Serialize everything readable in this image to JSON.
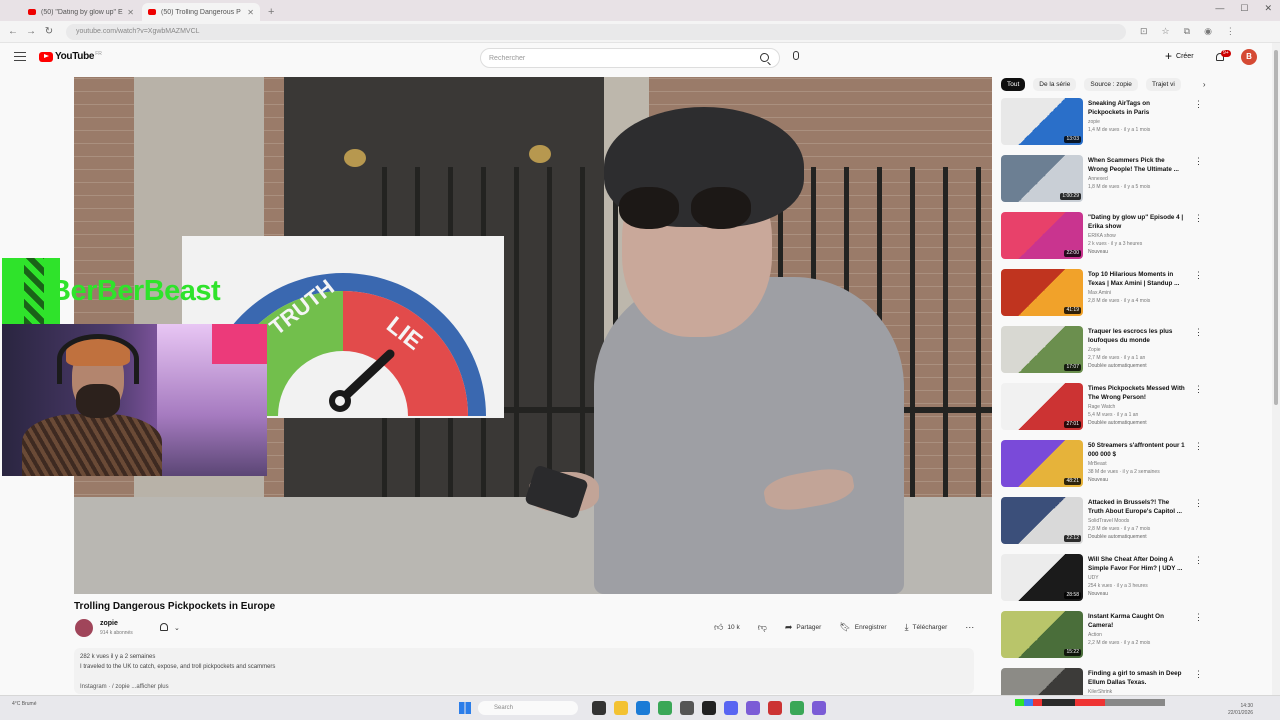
{
  "browser": {
    "tabs": [
      {
        "title": "(50) \"Dating by glow up\" Ep",
        "active": false
      },
      {
        "title": "(50) Trolling Dangerous P",
        "active": true
      }
    ],
    "new_tab": "+",
    "url": "youtube.com/watch?v=XgwbMAZMVCL"
  },
  "header": {
    "logo_text": "YouTube",
    "logo_cc": "FR",
    "search_placeholder": "Rechercher",
    "create_label": "Créer",
    "notifications": "9+",
    "avatar_letter": "B"
  },
  "overlay": {
    "streamer_name": "BerBerBeast",
    "gauge_left": "TRUTH",
    "gauge_right": "LIE"
  },
  "video": {
    "title": "Trolling Dangerous Pickpockets in Europe",
    "channel": "zopie",
    "subs": "914 k abonnés",
    "likes": "10 k",
    "share": "Partager",
    "save": "Enregistrer",
    "download": "Télécharger",
    "views_date": "282 k vues  il y a 2 semaines",
    "description": "I traveled to the UK to catch, expose, and troll pickpockets and scammers",
    "tags": "Instagram  ·  / zopie  ...afficher plus"
  },
  "chips": [
    "Tout",
    "De la série",
    "Source : zopie",
    "Trajet vi"
  ],
  "recommendations": [
    {
      "title": "Sneaking AirTags on Pickpockets in Paris",
      "channel": "zopie",
      "meta": "1,4 M de vues · il y a 1 mois",
      "badge": "",
      "duration": "13:03",
      "colors": [
        "#e8e8e8",
        "#2a6fc9"
      ]
    },
    {
      "title": "When Scammers Pick the Wrong People! The Ultimate ...",
      "channel": "Annexed",
      "meta": "1,8 M de vues · il y a 5 mois",
      "badge": "",
      "duration": "1:00:29",
      "colors": [
        "#6c7f93",
        "#c9cfd6"
      ]
    },
    {
      "title": "\"Dating by glow up\" Episode 4 | Erika show",
      "channel": "ERIKA show",
      "meta": "2 k vues · il y a 3 heures",
      "badge": "Nouveau",
      "duration": "22:00",
      "colors": [
        "#e8416a",
        "#c9348f"
      ]
    },
    {
      "title": "Top 10 Hilarious Moments in Texas | Max Amini | Standup ...",
      "channel": "Max Amini",
      "meta": "2,8 M de vues · il y a 4 mois",
      "badge": "",
      "duration": "41:19",
      "colors": [
        "#c0341f",
        "#f1a22a"
      ]
    },
    {
      "title": "Traquer les escrocs les plus loufoques du monde",
      "channel": "Zopie",
      "meta": "2,7 M de vues · il y a 1 an",
      "badge": "Doublée automatiquement",
      "duration": "17:07",
      "colors": [
        "#d8d8d2",
        "#6b8f4e"
      ]
    },
    {
      "title": "Times Pickpockets Messed With The Wrong Person!",
      "channel": "Rage Watch",
      "meta": "5,4 M vues · il y a 1 an",
      "badge": "Doublée automatiquement",
      "duration": "27:01",
      "colors": [
        "#f1f1f1",
        "#c33"
      ]
    },
    {
      "title": "50 Streamers s'affrontent pour 1 000 000 $",
      "channel": "MrBeast",
      "meta": "38 M de vues · il y a 2 semaines",
      "badge": "Nouveau",
      "duration": "48:21",
      "colors": [
        "#7a4ad9",
        "#e6b33a"
      ]
    },
    {
      "title": "Attacked in Brussels?! The Truth About Europe's Capitol ...",
      "channel": "SolidTravel Moods",
      "meta": "2,8 M de vues · il y a 7 mois",
      "badge": "Doublée automatiquement",
      "duration": "22:12",
      "colors": [
        "#3b4f7a",
        "#d9d9d9"
      ]
    },
    {
      "title": "Will She Cheat After Doing A Simple Favor For Him? | UDY ...",
      "channel": "UDY",
      "meta": "254 k vues · il y a 3 heures",
      "badge": "Nouveau",
      "duration": "28:58",
      "colors": [
        "#ececec",
        "#1b1b1b"
      ]
    },
    {
      "title": "Instant Karma Caught On Camera!",
      "channel": "Action",
      "meta": "2,2 M de vues · il y a 2 mois",
      "badge": "",
      "duration": "15:22",
      "colors": [
        "#b9c56a",
        "#4a6e3a"
      ]
    },
    {
      "title": "Finding a girl to smash in Deep Ellum Dallas Texas.",
      "channel": "KilerShrink",
      "meta": "10 k vues · il y a 1 heure",
      "badge": "",
      "duration": "1:40:58",
      "colors": [
        "#8c8b86",
        "#3c3b39"
      ]
    }
  ],
  "taskbar": {
    "weather": "4°C  Brumé",
    "search": "Search",
    "time": "14:30",
    "date": "22/01/2026"
  }
}
